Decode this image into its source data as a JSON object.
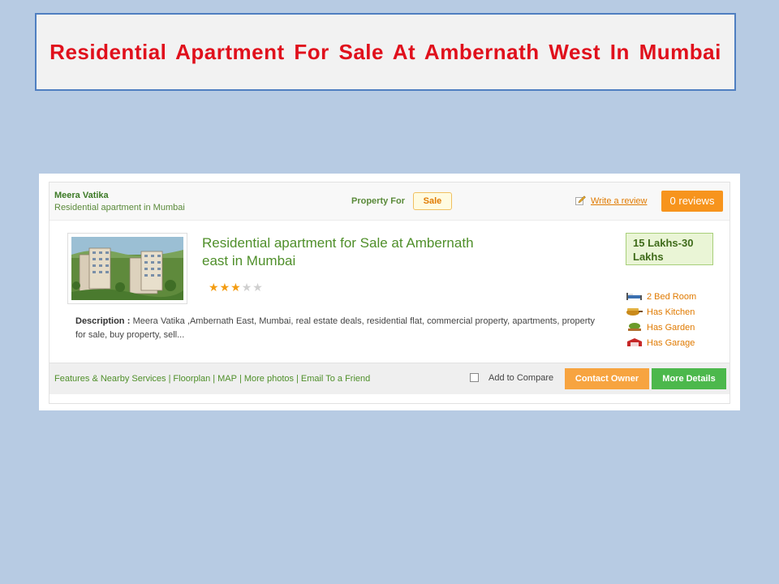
{
  "slide": {
    "title": "Residential Apartment For Sale At Ambernath West In Mumbai"
  },
  "listing": {
    "name": "Meera Vatika",
    "subtitle": "Residential apartment in Mumbai",
    "property_for_label": "Property For",
    "property_for_value": "Sale",
    "write_review": "Write a review",
    "reviews_button": "0 reviews",
    "title": "Residential apartment for Sale at Ambernath east in Mumbai",
    "rating": {
      "value": 3,
      "max": 5
    },
    "description_label": "Description :",
    "description": "Meera Vatika ,Ambernath East, Mumbai, real estate deals, residential flat, commercial property, apartments, property for sale, buy property, sell...",
    "price": "15 Lakhs-30 Lakhs",
    "features": [
      {
        "icon": "bed-icon",
        "label": "2 Bed Room"
      },
      {
        "icon": "kitchen-icon",
        "label": "Has Kitchen"
      },
      {
        "icon": "garden-icon",
        "label": "Has Garden"
      },
      {
        "icon": "garage-icon",
        "label": "Has Garage"
      }
    ],
    "links": [
      "Features & Nearby Services",
      "Floorplan",
      "MAP",
      "More photos",
      "Email To a Friend"
    ],
    "add_to_compare": "Add to Compare",
    "compare_checked": false,
    "contact_button": "Contact Owner",
    "details_button": "More Details"
  },
  "colors": {
    "background": "#b7cbe3",
    "title_red": "#e0101c",
    "accent_green": "#4f8f2a",
    "accent_orange": "#f7941d",
    "button_green": "#4cb84c"
  }
}
